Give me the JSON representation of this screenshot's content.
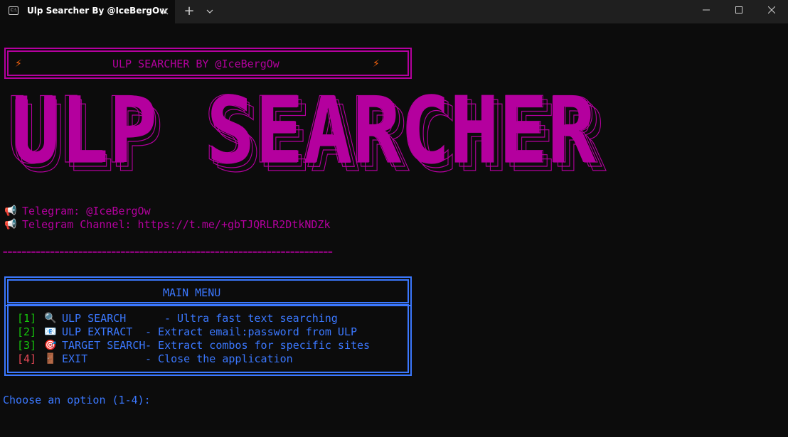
{
  "window": {
    "tab_title": "Ulp Searcher By @IceBergOw",
    "tab_icon": "terminal-icon",
    "new_tab": "+",
    "dropdown": "⌄"
  },
  "header": {
    "banner_text": "ULP SEARCHER BY @IceBergOw",
    "bolt": "⚡",
    "big_logo": "ULP SEARCHER"
  },
  "contacts": [
    {
      "icon": "📢",
      "text": "Telegram: @IceBergOw"
    },
    {
      "icon": "📢",
      "text": "Telegram Channel: https://t.me/+gbTJQRLR2DtkNDZk"
    }
  ],
  "divider": "======================================================================",
  "menu": {
    "title": "MAIN MENU",
    "items": [
      {
        "key": "[1]",
        "icon": "🔍",
        "label": "ULP SEARCH    ",
        "desc": "- Ultra fast text searching"
      },
      {
        "key": "[2]",
        "icon": "📧",
        "label": "ULP EXTRACT  ",
        "desc": "- Extract email:password from ULP"
      },
      {
        "key": "[3]",
        "icon": "🎯",
        "label": "TARGET SEARCH",
        "desc": "- Extract combos for specific sites"
      },
      {
        "key": "[4]",
        "icon": "🚪",
        "label": "EXIT         ",
        "desc": "- Close the application"
      }
    ]
  },
  "prompt": "Choose an option (1-4):",
  "colors": {
    "magenta": "#b4009e",
    "blue": "#3b78ff",
    "green": "#16c60c",
    "red": "#e74856",
    "background": "#0c0c0c"
  }
}
